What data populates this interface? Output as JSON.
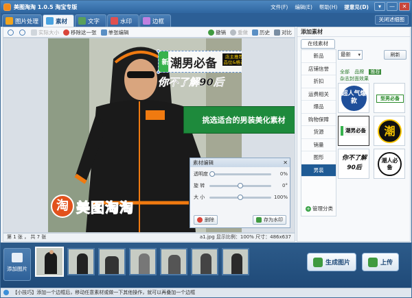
{
  "app": {
    "title": "美图淘淘 1.0.5 淘宝专版",
    "menu": [
      "文件(F)",
      "编辑(E)",
      "帮助(H)"
    ],
    "user": "提意见(D)",
    "window_buttons": [
      "▾",
      "—",
      "✕"
    ]
  },
  "tabs": [
    {
      "label": "图片处理",
      "icon_color": "#f0a41d"
    },
    {
      "label": "素材",
      "icon_color": "#4aa3e0",
      "active": true
    },
    {
      "label": "文字",
      "icon_color": "#5aa05a"
    },
    {
      "label": "水印",
      "icon_color": "#e05050"
    },
    {
      "label": "边框",
      "icon_color": "#c080e0"
    }
  ],
  "close_template": "关闭述细图",
  "toolbar": {
    "zoom_in": "",
    "zoom_out": "",
    "actual_size": "实际大小",
    "remove_one": "移除这一张",
    "single_edit": "单张编辑",
    "undo": "撤销",
    "redo": "重做",
    "history": "历史",
    "compare": "对比"
  },
  "canvas": {
    "sticker1_new": "新",
    "sticker1_main": "潮男必备",
    "sticker1_tag": "店主推荐 品位&格调",
    "sticker2": "你不了解90后",
    "watermark_logo": "淘",
    "watermark_text": "美图淘淘",
    "callout": "挑选适合的男装美化素材"
  },
  "edit_panel": {
    "title": "素材编辑",
    "close": "✕",
    "rows": [
      {
        "label": "透明度",
        "value": "0%",
        "pos": 0.0
      },
      {
        "label": "旋 转",
        "value": "0°",
        "pos": 0.5
      },
      {
        "label": "大 小",
        "value": "100%",
        "pos": 0.5
      }
    ],
    "delete_label": "删除",
    "save_watermark_label": "存为水印"
  },
  "status": {
    "page": "第 1 张 ， 共 7 张",
    "info": "a1.jpg   显示比例：100%   尺寸：486x637"
  },
  "right_panel": {
    "title": "添加素材",
    "online_tab": "在线素材",
    "categories": [
      "新品",
      "店铺信誉",
      "折扣",
      "运费相关",
      "爆品",
      "购物保障",
      "货源",
      "销量",
      "图形",
      "男装"
    ],
    "active_category": "男装",
    "manage": "管理分类",
    "sort_label": "最新",
    "refresh_label": "刷新",
    "filters": [
      "全部",
      "品牌",
      "推荐"
    ],
    "active_filter": "推荐",
    "filter2": "杂志封面效果",
    "thumbs": [
      {
        "text": "超人气爆款",
        "bg": "#1f4f9a",
        "fg": "#ffffff"
      },
      {
        "text": "型男必备",
        "bg": "#ffffff",
        "fg": "#2a8a2a"
      },
      {
        "text": "潮男必备",
        "bg": "#ffffff",
        "fg": "#111111"
      },
      {
        "text": "潮",
        "bg": "#111111",
        "fg": "#f5c400"
      },
      {
        "text": "你不了解90后",
        "bg": "#ffffff",
        "fg": "#111111"
      },
      {
        "text": "潮人必备",
        "bg": "#ffffff",
        "fg": "#111111"
      }
    ]
  },
  "filmstrip": {
    "add_label": "添加图片",
    "count": 7,
    "generate_label": "生成图片",
    "upload_label": "上传"
  },
  "hint": "【小技巧】添加一个边框后，移动任意素材或做一下其他操作，就可以再叠加一个边框"
}
